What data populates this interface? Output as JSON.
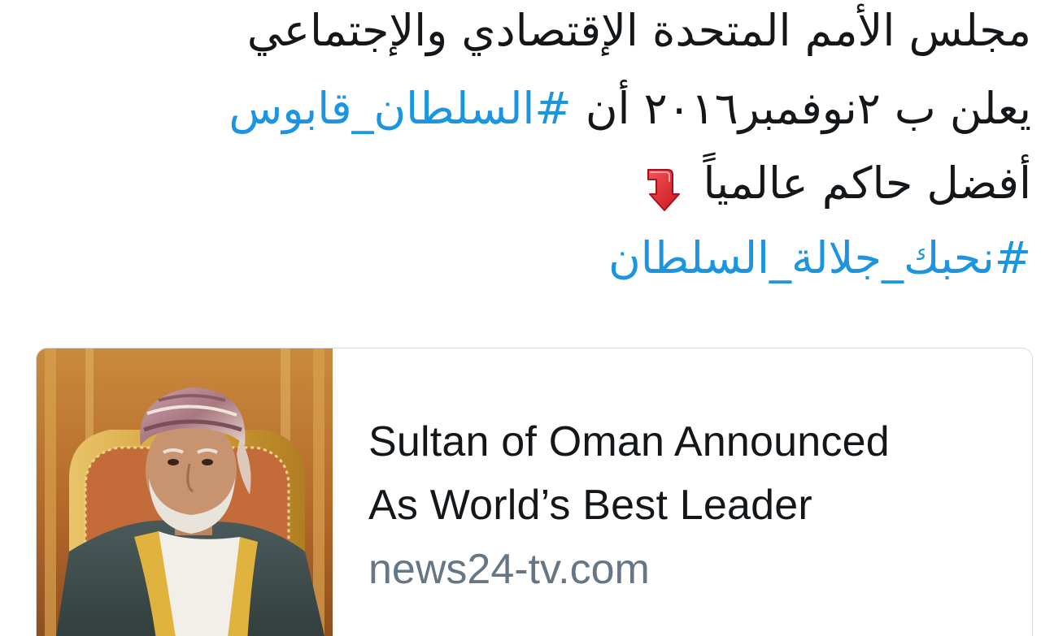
{
  "tweet": {
    "line1": "مجلس الأمم المتحدة الإقتصادي والإجتماعي",
    "line2_text": "يعلن ب ٢نوفمبر٢٠١٦ أن",
    "line2_hashtag": "#السلطان_قابوس",
    "line3_text": "أفضل حاكم عالمياً",
    "line3_emoji": "arrow-down-red-icon",
    "line4_hashtag": "#نحبك_جلالة_السلطان"
  },
  "card": {
    "title_line1": "Sultan of Oman Announced",
    "title_line2": "As World’s Best Leader",
    "domain": "news24-tv.com"
  },
  "colors": {
    "hashtag": "#1b95e0",
    "text": "#14171a",
    "domain": "#657786",
    "border": "#d6dee4",
    "emoji_red": "#e0242b"
  }
}
